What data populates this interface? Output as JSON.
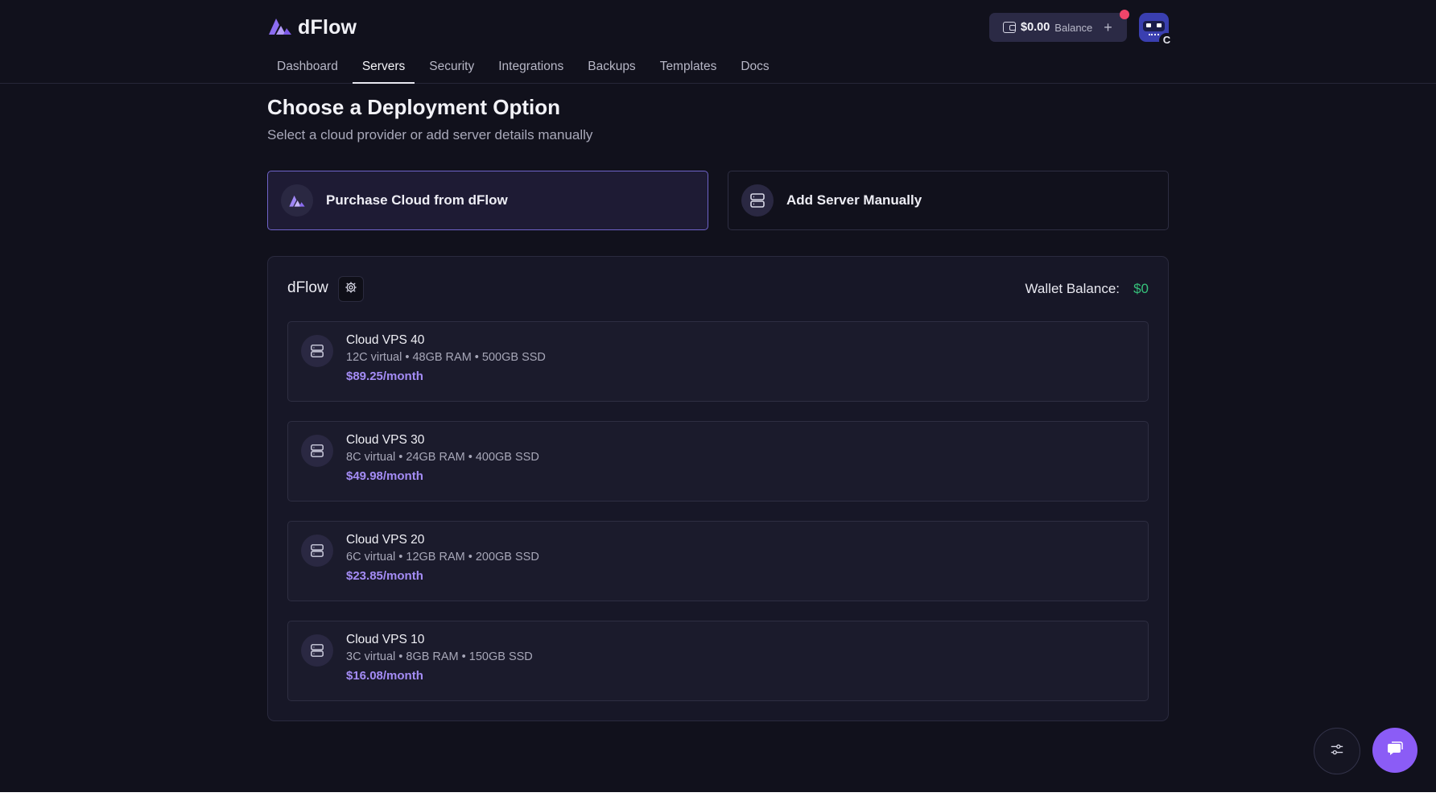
{
  "brand": {
    "name": "dFlow",
    "accent": "#8b5cf6"
  },
  "header": {
    "nav": [
      {
        "label": "Dashboard",
        "active": false
      },
      {
        "label": "Servers",
        "active": true
      },
      {
        "label": "Security",
        "active": false
      },
      {
        "label": "Integrations",
        "active": false
      },
      {
        "label": "Backups",
        "active": false
      },
      {
        "label": "Templates",
        "active": false
      },
      {
        "label": "Docs",
        "active": false
      }
    ],
    "balance": {
      "amount": "$0.00",
      "label": "Balance",
      "icon": "wallet-icon"
    },
    "avatar_badge": "C"
  },
  "page": {
    "title": "Choose a Deployment Option",
    "subtitle": "Select a cloud provider or add server details manually"
  },
  "options": [
    {
      "label": "Purchase Cloud from dFlow",
      "icon": "dflow-logo-icon",
      "selected": true
    },
    {
      "label": "Add Server Manually",
      "icon": "server-icon",
      "selected": false
    }
  ],
  "provider": {
    "name": "dFlow",
    "wallet_label": "Wallet Balance:",
    "wallet_value": "$0",
    "wallet_color": "#36c07a"
  },
  "plans": [
    {
      "name": "Cloud VPS 40",
      "specs": "12C virtual • 48GB RAM • 500GB SSD",
      "price": "$89.25/month"
    },
    {
      "name": "Cloud VPS 30",
      "specs": "8C virtual • 24GB RAM • 400GB SSD",
      "price": "$49.98/month"
    },
    {
      "name": "Cloud VPS 20",
      "specs": "6C virtual • 12GB RAM • 200GB SSD",
      "price": "$23.85/month"
    },
    {
      "name": "Cloud VPS 10",
      "specs": "3C virtual • 8GB RAM • 150GB SSD",
      "price": "$16.08/month"
    }
  ]
}
